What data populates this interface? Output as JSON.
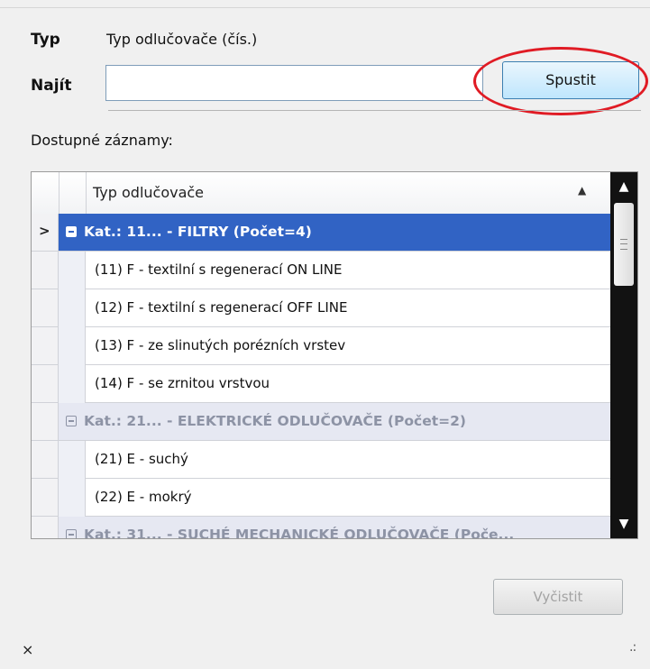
{
  "form": {
    "type_label": "Typ",
    "type_value": "Typ odlučovače (čís.)",
    "search_label": "Najít",
    "search_value": "",
    "run_button": "Spustit",
    "available_label": "Dostupné záznamy:",
    "clear_button": "Vyčistit"
  },
  "grid": {
    "column_header": "Typ odlučovače",
    "sort_glyph": "▲",
    "current_row_glyph": ">",
    "groups": [
      {
        "label": "Kat.: 11... - FILTRY (Počet=4)",
        "items": [
          "(11) F - textilní s regenerací ON LINE",
          "(12) F - textilní s regenerací OFF LINE",
          "(13) F - ze slinutých porézních vrstev",
          "(14) F - se zrnitou vrstvou"
        ]
      },
      {
        "label": "Kat.: 21... - ELEKTRICKÉ ODLUČOVAČE (Počet=2)",
        "items": [
          "(21) E - suchý",
          "(22) E - mokrý"
        ]
      },
      {
        "label": "Kat.: 31... - SUCHÉ MECHANICKÉ ODLUČOVAČE (Poče...",
        "items": []
      }
    ]
  },
  "icons": {
    "close": "×",
    "resize": ".:",
    "scroll_up": "▲",
    "scroll_down": "▼"
  },
  "colors": {
    "selection": "#3163c4",
    "highlight_ellipse": "#e01b24"
  }
}
